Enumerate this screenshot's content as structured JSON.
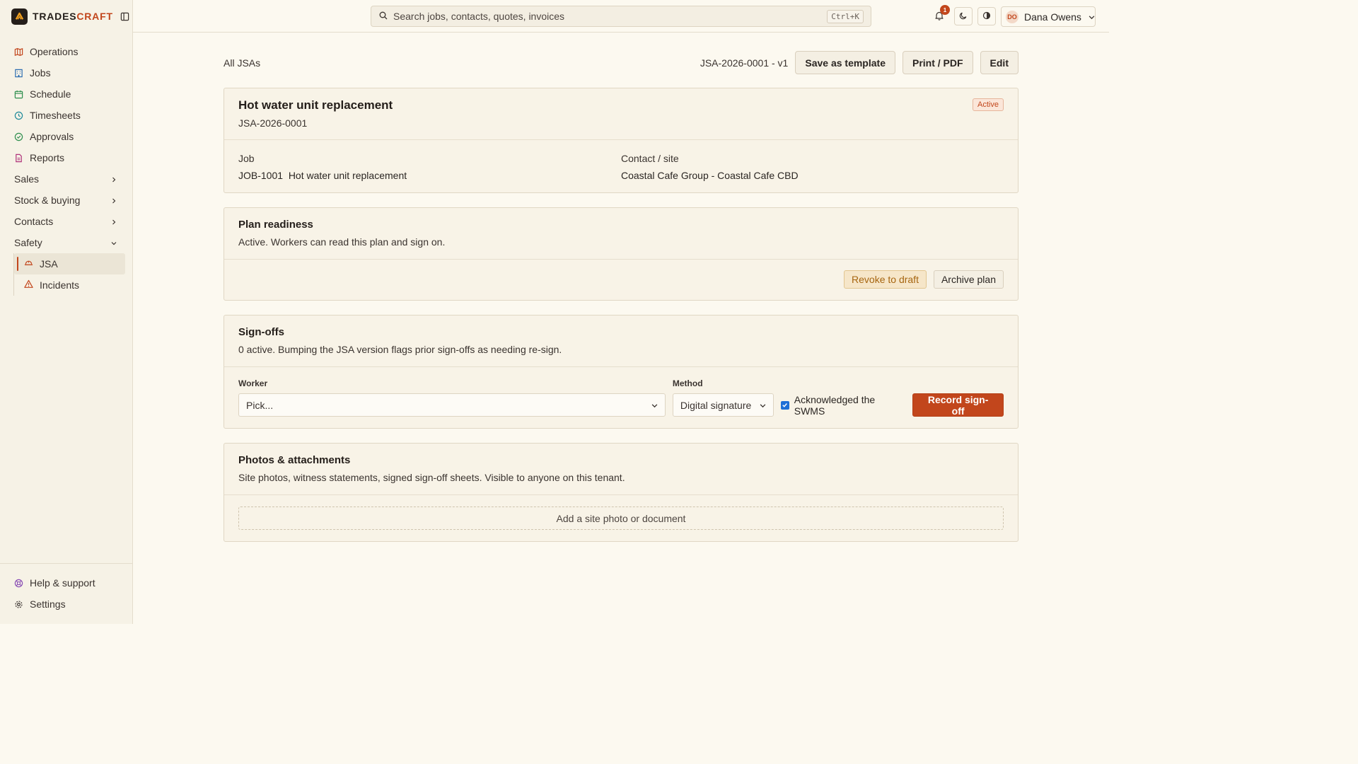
{
  "brand": {
    "name_a": "TRADES",
    "name_b": "CRAFT"
  },
  "sidebar": {
    "items": [
      {
        "label": "Operations",
        "icon": "map-icon",
        "color": "#c2461c"
      },
      {
        "label": "Jobs",
        "icon": "building-icon",
        "color": "#2b6cb0"
      },
      {
        "label": "Schedule",
        "icon": "calendar-icon",
        "color": "#2f8f4e"
      },
      {
        "label": "Timesheets",
        "icon": "clock-icon",
        "color": "#1f8a9a"
      },
      {
        "label": "Approvals",
        "icon": "check-circle-icon",
        "color": "#2f8f4e"
      },
      {
        "label": "Reports",
        "icon": "file-icon",
        "color": "#b0337a"
      }
    ],
    "groups": [
      {
        "label": "Sales"
      },
      {
        "label": "Stock & buying"
      },
      {
        "label": "Contacts"
      },
      {
        "label": "Safety"
      }
    ],
    "safety_sub": [
      {
        "label": "JSA",
        "icon": "hard-hat-icon"
      },
      {
        "label": "Incidents",
        "icon": "warning-triangle-icon"
      }
    ],
    "bottom": [
      {
        "label": "Help & support",
        "icon": "lifebuoy-icon"
      },
      {
        "label": "Settings",
        "icon": "gear-icon"
      }
    ]
  },
  "topbar": {
    "search_placeholder": "Search jobs, contacts, quotes, invoices",
    "search_shortcut": "Ctrl+K",
    "notification_count": "1",
    "user_initials": "DO",
    "user_name": "Dana Owens"
  },
  "header": {
    "breadcrumb": "All JSAs",
    "doc_version": "JSA-2026-0001 - v1",
    "save_template": "Save as template",
    "print_pdf": "Print / PDF",
    "edit": "Edit"
  },
  "summary": {
    "title": "Hot water unit replacement",
    "id": "JSA-2026-0001",
    "status": "Active",
    "job_label": "Job",
    "job_value": "JOB-1001  Hot water unit replacement",
    "contact_label": "Contact / site",
    "contact_value": "Coastal Cafe Group - Coastal Cafe CBD"
  },
  "readiness": {
    "title": "Plan readiness",
    "desc": "Active. Workers can read this plan and sign on.",
    "revoke": "Revoke to draft",
    "archive": "Archive plan"
  },
  "signoffs": {
    "title": "Sign-offs",
    "desc": "0 active. Bumping the JSA version flags prior sign-offs as needing re-sign.",
    "worker_label": "Worker",
    "worker_value": "Pick...",
    "method_label": "Method",
    "method_value": "Digital signature",
    "ack_label": "Acknowledged the SWMS",
    "ack_checked": true,
    "record": "Record sign-off"
  },
  "attachments": {
    "title": "Photos & attachments",
    "desc": "Site photos, witness statements, signed sign-off sheets. Visible to anyone on this tenant.",
    "add": "Add a site photo or document"
  }
}
